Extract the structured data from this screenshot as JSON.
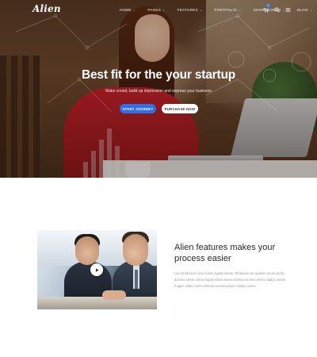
{
  "nav": {
    "logo": "Alien",
    "items": [
      {
        "label": "HOME"
      },
      {
        "label": "PAGES"
      },
      {
        "label": "FEATURES"
      },
      {
        "label": "PORTFOLIO"
      },
      {
        "label": "SHORTCODES"
      },
      {
        "label": "BLOG"
      }
    ],
    "icons": [
      "cart-icon",
      "search-icon",
      "menu-icon"
    ],
    "cart_count": "0"
  },
  "hero": {
    "title": "Best fit for the your startup",
    "subtitle": "Make crowd, build up impression and express your business",
    "primary_button": "START JOURNEY",
    "secondary_button": "PURCHASE NOW"
  },
  "feature": {
    "title": "Alien features makes your process easier",
    "text": "Lid est laborum dolo rumes fugats untras. Etharums ser quidem rerum facilis dolores nemis omnis fugats vitaes nemo minima rerums unsers sadips amets. Fugats vitaes nemo minima rerums unsers sadips amets."
  },
  "colors": {
    "accent": "#2f6fe8",
    "white": "#ffffff"
  }
}
